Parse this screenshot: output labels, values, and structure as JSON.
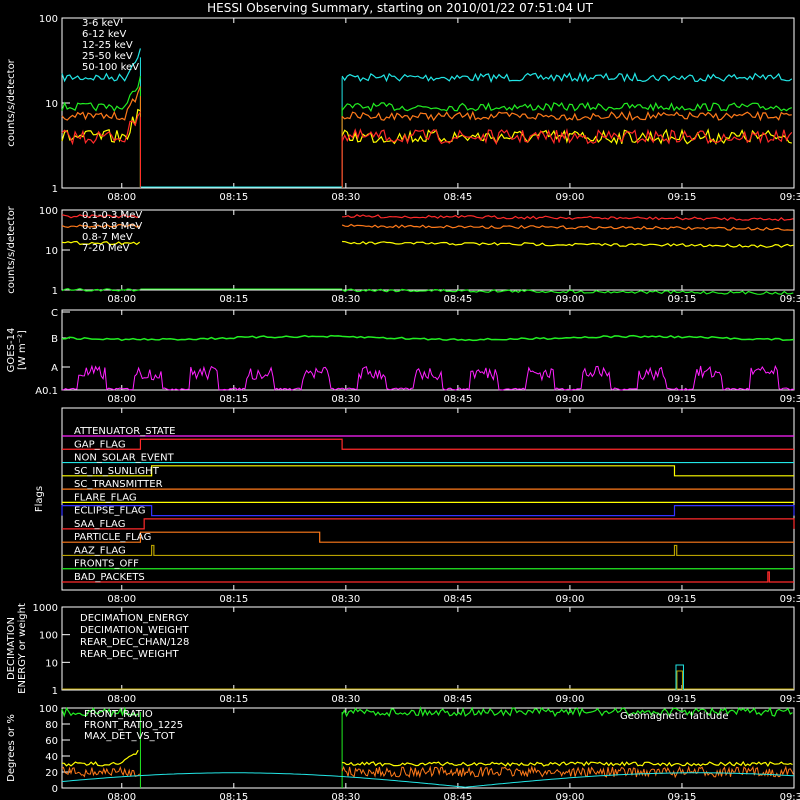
{
  "title": "HESSI Observing Summary, starting on 2010/01/22 07:51:04 UT",
  "x_ticks": [
    "08:00",
    "08:15",
    "08:30",
    "08:45",
    "09:00",
    "09:15",
    "09:30"
  ],
  "x_tick_minutes": [
    8,
    23,
    38,
    53,
    68,
    83,
    98
  ],
  "x_range_minutes": [
    0,
    98
  ],
  "colors": {
    "red": "#ff2a2a",
    "orange": "#ff7a1a",
    "yellow": "#ffff00",
    "green": "#22ee22",
    "cyan": "#22e6e6",
    "magenta": "#ff22ff",
    "blue": "#3333ff",
    "olive": "#b8a000",
    "white": "#ffffff"
  },
  "chart_data": [
    {
      "type": "line",
      "ylabel": "counts/s/detector",
      "yscale": "log",
      "ylim": [
        1,
        100
      ],
      "y_ticks": [
        "1",
        "10",
        "100"
      ],
      "series": [
        {
          "name": "3-6 keV",
          "color": "#ff2a2a",
          "level": 4
        },
        {
          "name": "6-12 keV",
          "color": "#ff7a1a",
          "level": 7
        },
        {
          "name": "12-25 keV",
          "color": "#ffff00",
          "level": 4
        },
        {
          "name": "25-50 keV",
          "color": "#22ee22",
          "level": 9
        },
        {
          "name": "50-100 keV",
          "color": "#22e6e6",
          "level": 20
        }
      ],
      "data_gap_minutes": [
        10.5,
        37.5
      ]
    },
    {
      "type": "line",
      "ylabel": "counts/s/detector",
      "yscale": "log",
      "ylim": [
        1,
        100
      ],
      "y_ticks": [
        "1",
        "10",
        "100"
      ],
      "series": [
        {
          "name": "0.1-0.3 MeV",
          "color": "#ff2a2a",
          "level": 70
        },
        {
          "name": "0.3-0.8 MeV",
          "color": "#ff7a1a",
          "level": 40
        },
        {
          "name": "0.8-7 MeV",
          "color": "#ffff00",
          "level": 15
        },
        {
          "name": "7-20 MeV",
          "color": "#22ee22",
          "level": 1
        }
      ]
    },
    {
      "type": "line",
      "ylabel": "GOES-14 [W m⁻²]",
      "y_ticks": [
        "A0.1",
        "A",
        "B",
        "C"
      ],
      "series": [
        {
          "name": "",
          "color": "#22ee22",
          "level": "B"
        },
        {
          "name": "",
          "color": "#ff22ff",
          "level": "A0.1"
        }
      ]
    },
    {
      "type": "table",
      "ylabel": "Flags",
      "flags": [
        {
          "name": "ATTENUATOR_STATE",
          "color": "#ff22ff",
          "on": []
        },
        {
          "name": "GAP_FLAG",
          "color": "#ff2a2a",
          "on": [
            [
              10.5,
              37.5
            ]
          ]
        },
        {
          "name": "NON_SOLAR_EVENT",
          "color": "#22e6e6",
          "on": []
        },
        {
          "name": "SC_IN_SUNLIGHT",
          "color": "#ffff00",
          "on": [
            [
              12,
              82
            ]
          ]
        },
        {
          "name": "SC_TRANSMITTER",
          "color": "#ff7a1a",
          "on": []
        },
        {
          "name": "FLARE_FLAG",
          "color": "#ffff00",
          "on": []
        },
        {
          "name": "ECLIPSE_FLAG",
          "color": "#3333ff",
          "on": [
            [
              0,
              12
            ],
            [
              82,
              98
            ]
          ]
        },
        {
          "name": "SAA_FLAG",
          "color": "#ff2a2a",
          "on": [
            [
              11,
              98
            ]
          ]
        },
        {
          "name": "PARTICLE_FLAG",
          "color": "#ff7a1a",
          "on": [
            [
              10.5,
              34.5
            ]
          ]
        },
        {
          "name": "AAZ_FLAG",
          "color": "#b8a000",
          "on": [
            [
              12,
              12.3
            ],
            [
              82,
              82.3
            ]
          ]
        },
        {
          "name": "FRONTS_OFF",
          "color": "#22ee22",
          "on": []
        },
        {
          "name": "BAD_PACKETS",
          "color": "#ff2a2a",
          "on": [
            [
              94.5,
              94.7
            ]
          ]
        }
      ]
    },
    {
      "type": "line",
      "ylabel": "DECIMATION ENERGY or weight",
      "yscale": "log",
      "ylim": [
        1,
        1000
      ],
      "y_ticks": [
        "1",
        "10",
        "100",
        "1000"
      ],
      "series": [
        {
          "name": "DECIMATION_ENERGY",
          "color": "#22ee22"
        },
        {
          "name": "DECIMATION_WEIGHT",
          "color": "#ff7a1a"
        },
        {
          "name": "REAR_DEC_CHAN/128",
          "color": "#22e6e6"
        },
        {
          "name": "REAR_DEC_WEIGHT",
          "color": "#b8a000"
        }
      ]
    },
    {
      "type": "line",
      "ylabel": "Degrees or %",
      "ylim": [
        0,
        100
      ],
      "y_ticks": [
        "0",
        "20",
        "40",
        "60",
        "80",
        "100"
      ],
      "series": [
        {
          "name": "FRONT_RATIO",
          "color": "#22ee22",
          "level": 95
        },
        {
          "name": "FRONT_RATIO_1225",
          "color": "#ffff00",
          "level": 30
        },
        {
          "name": "MAX_DET_VS_TOT",
          "color": "#ff7a1a",
          "level": 20
        },
        {
          "name": "Geomagnetic Latitude",
          "color": "#22e6e6"
        }
      ],
      "annotation": "Geomagnetic latitude"
    }
  ]
}
